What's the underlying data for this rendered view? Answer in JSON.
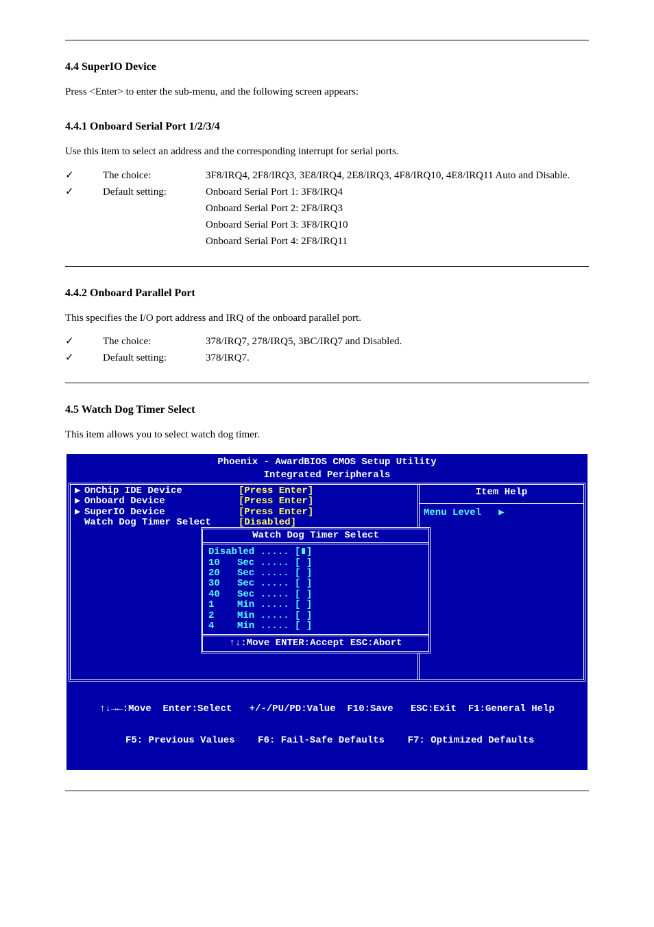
{
  "doc": {
    "sec44_title": "4.4 SuperIO Device",
    "sec44_intro": "Press <Enter> to enter the sub-menu, and the following screen appears:",
    "subA_title": "4.4.1 Onboard Serial Port 1/2/3/4",
    "subA_text1": "Use this item to select an address and the corresponding interrupt for serial ports.",
    "rowA1_label": "The choice:",
    "rowA1_value": "3F8/IRQ4, 2F8/IRQ3, 3E8/IRQ4, 2E8/IRQ3, 4F8/IRQ10, 4E8/IRQ11 Auto and Disable.",
    "rowA2_label": "Default setting:",
    "rowA2_value1": "Onboard Serial Port 1: 3F8/IRQ4",
    "rowA2_value2": "Onboard Serial Port 2: 2F8/IRQ3",
    "rowA2_value3": "Onboard Serial Port 3: 3F8/IRQ10",
    "rowA2_value4": "Onboard Serial Port 4: 2F8/IRQ11",
    "subB_title": "4.4.2 Onboard Parallel Port",
    "subB_text": "This specifies the I/O port address and IRQ of the onboard parallel port.",
    "rowB1_label": "The choice:",
    "rowB1_value": "378/IRQ7, 278/IRQ5, 3BC/IRQ7 and Disabled.",
    "rowB2_label": "Default setting:",
    "rowB2_value": "378/IRQ7.",
    "sec45_title": "4.5 Watch Dog Timer Select",
    "sec45_text": "This item allows you to select watch dog timer."
  },
  "bios": {
    "title1": "Phoenix - AwardBIOS CMOS Setup Utility",
    "title2": "Integrated Peripherals",
    "items": [
      {
        "name": "OnChip IDE Device",
        "value": "[Press Enter]",
        "submenu": true
      },
      {
        "name": "Onboard Device",
        "value": "[Press Enter]",
        "submenu": true
      },
      {
        "name": "SuperIO Device",
        "value": "[Press Enter]",
        "submenu": true
      },
      {
        "name": "Watch Dog Timer Select",
        "value": "[Disabled]",
        "submenu": false
      }
    ],
    "help_title": "Item Help",
    "menu_level_label": "Menu Level",
    "popup": {
      "title": "Watch Dog Timer Select",
      "options": [
        {
          "label": "Disabled",
          "mark": "∎"
        },
        {
          "label": "10   Sec",
          "mark": " "
        },
        {
          "label": "20   Sec",
          "mark": " "
        },
        {
          "label": "30   Sec",
          "mark": " "
        },
        {
          "label": "40   Sec",
          "mark": " "
        },
        {
          "label": "1    Min",
          "mark": " "
        },
        {
          "label": "2    Min",
          "mark": " "
        },
        {
          "label": "4    Min",
          "mark": " "
        }
      ],
      "hint": "↑↓:Move ENTER:Accept ESC:Abort"
    },
    "footer1": "↑↓→←:Move  Enter:Select   +/-/PU/PD:Value  F10:Save   ESC:Exit  F1:General Help",
    "footer2": " F5: Previous Values    F6: Fail-Safe Defaults    F7: Optimized Defaults"
  },
  "check": "✓"
}
